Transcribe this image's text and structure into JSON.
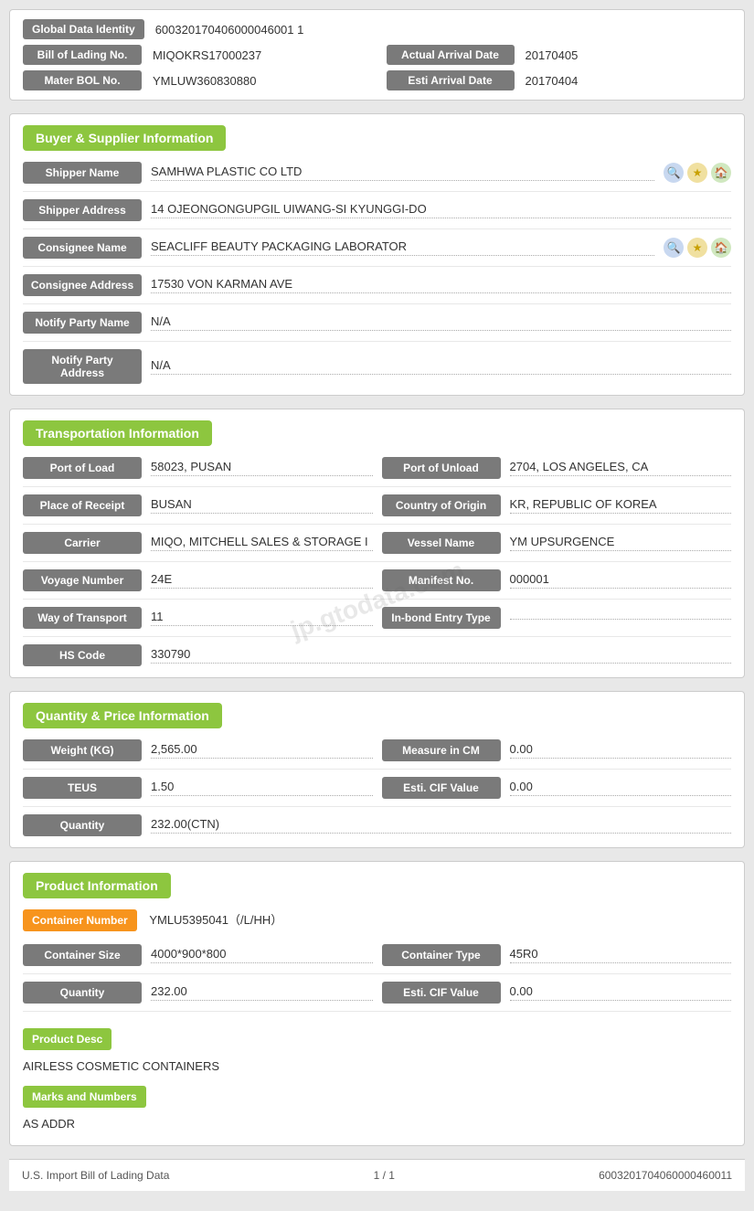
{
  "identity": {
    "global_id_label": "Global Data Identity",
    "global_id_value": "600320170406000046001 1",
    "bol_label": "Bill of Lading No.",
    "bol_value": "MIQOKRS17000237",
    "actual_arrival_label": "Actual Arrival Date",
    "actual_arrival_value": "20170405",
    "master_bol_label": "Mater BOL No.",
    "master_bol_value": "YMLUW360830880",
    "esti_arrival_label": "Esti Arrival Date",
    "esti_arrival_value": "20170404"
  },
  "buyer_supplier": {
    "section_title": "Buyer & Supplier Information",
    "shipper_name_label": "Shipper Name",
    "shipper_name_value": "SAMHWA PLASTIC CO LTD",
    "shipper_address_label": "Shipper Address",
    "shipper_address_value": "14 OJEONGONGUPGIL UIWANG-SI KYUNGGI-DO",
    "consignee_name_label": "Consignee Name",
    "consignee_name_value": "SEACLIFF BEAUTY PACKAGING LABORATOR",
    "consignee_address_label": "Consignee Address",
    "consignee_address_value": "17530 VON KARMAN AVE",
    "notify_party_name_label": "Notify Party Name",
    "notify_party_name_value": "N/A",
    "notify_party_address_label": "Notify Party Address",
    "notify_party_address_value": "N/A"
  },
  "transportation": {
    "section_title": "Transportation Information",
    "port_of_load_label": "Port of Load",
    "port_of_load_value": "58023, PUSAN",
    "port_of_unload_label": "Port of Unload",
    "port_of_unload_value": "2704, LOS ANGELES, CA",
    "place_of_receipt_label": "Place of Receipt",
    "place_of_receipt_value": "BUSAN",
    "country_of_origin_label": "Country of Origin",
    "country_of_origin_value": "KR, REPUBLIC OF KOREA",
    "carrier_label": "Carrier",
    "carrier_value": "MIQO, MITCHELL SALES & STORAGE I",
    "vessel_name_label": "Vessel Name",
    "vessel_name_value": "YM UPSURGENCE",
    "voyage_number_label": "Voyage Number",
    "voyage_number_value": "24E",
    "manifest_no_label": "Manifest No.",
    "manifest_no_value": "000001",
    "way_of_transport_label": "Way of Transport",
    "way_of_transport_value": "11",
    "in_bond_label": "In-bond Entry Type",
    "in_bond_value": "",
    "hs_code_label": "HS Code",
    "hs_code_value": "330790"
  },
  "quantity_price": {
    "section_title": "Quantity & Price Information",
    "weight_label": "Weight (KG)",
    "weight_value": "2,565.00",
    "measure_label": "Measure in CM",
    "measure_value": "0.00",
    "teus_label": "TEUS",
    "teus_value": "1.50",
    "esti_cif_label": "Esti. CIF Value",
    "esti_cif_value": "0.00",
    "quantity_label": "Quantity",
    "quantity_value": "232.00(CTN)"
  },
  "product": {
    "section_title": "Product Information",
    "container_number_label": "Container Number",
    "container_number_value": "YMLU5395041（/L/HH）",
    "container_size_label": "Container Size",
    "container_size_value": "4000*900*800",
    "container_type_label": "Container Type",
    "container_type_value": "45R0",
    "quantity_label": "Quantity",
    "quantity_value": "232.00",
    "esti_cif_label": "Esti. CIF Value",
    "esti_cif_value": "0.00",
    "product_desc_label": "Product Desc",
    "product_desc_value": "AIRLESS COSMETIC CONTAINERS",
    "marks_label": "Marks and Numbers",
    "marks_value": "AS ADDR"
  },
  "footer": {
    "left": "U.S. Import Bill of Lading Data",
    "center": "1 / 1",
    "right": "6003201704060000460011"
  },
  "watermark": "jp.gtodata.com"
}
